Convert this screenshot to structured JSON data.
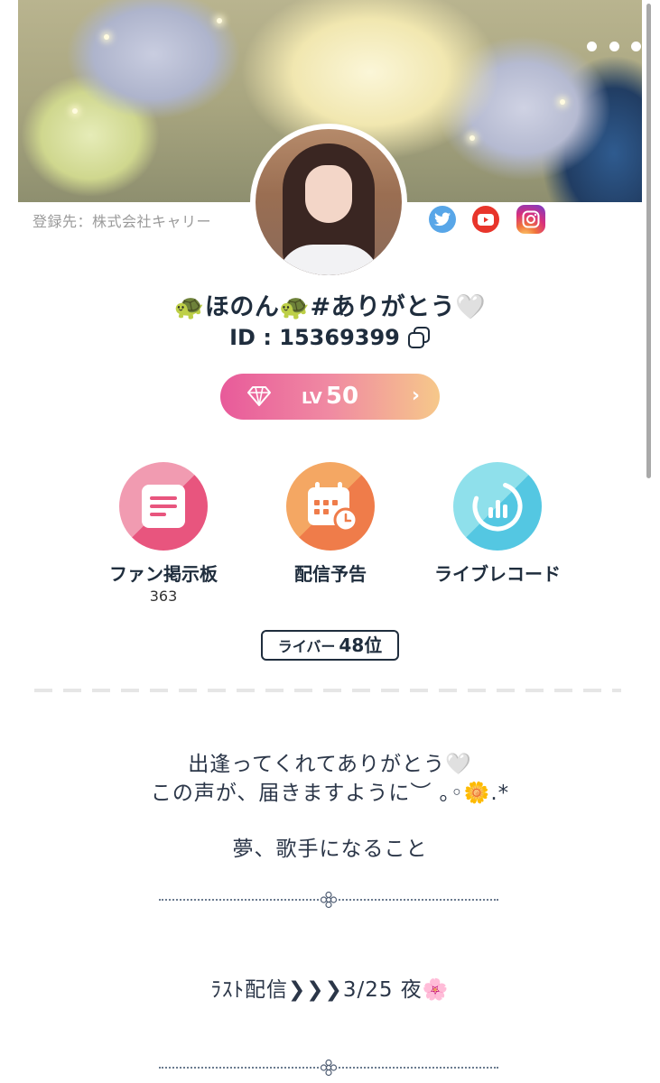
{
  "profile": {
    "agency": "登録先：株式会社キャリー",
    "name": "🐢ほのん🐢#ありがとう🤍",
    "id_text": "ID : 15369399",
    "level_prefix": "LV",
    "level_value": "50",
    "rank_label": "ライバー",
    "rank_value": "48位"
  },
  "social": [
    "twitter-icon",
    "youtube-icon",
    "instagram-icon"
  ],
  "features": [
    {
      "label": "ファン掲示板",
      "count": "363",
      "icon": "board-icon"
    },
    {
      "label": "配信予告",
      "count": "",
      "icon": "calendar-icon"
    },
    {
      "label": "ライブレコード",
      "count": "",
      "icon": "record-icon"
    }
  ],
  "bio": {
    "line1": "出逢ってくれてありがとう🤍",
    "line2": "この声が、届きますように︶ ｡◦🌼.*",
    "line3": "夢、歌手になること",
    "line4": "ﾗｽﾄ配信❯❯❯3/25 夜🌸"
  },
  "colors": {
    "text": "#1f2d3d",
    "level_gradient_start": "#e85a9a",
    "level_gradient_end": "#f6c88a",
    "fan_board": "#e8557e",
    "schedule": "#ef7c4a",
    "record": "#54c7e2"
  }
}
